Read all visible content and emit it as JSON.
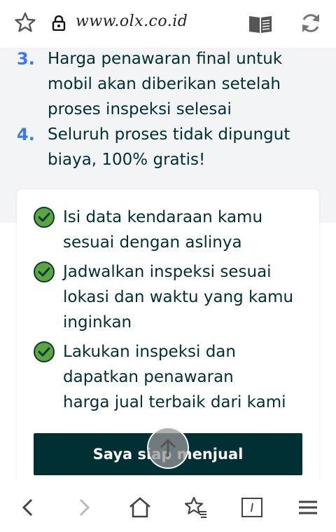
{
  "browser": {
    "url": "www.olx.co.id"
  },
  "steps": [
    {
      "num": "3.",
      "lines": [
        "Harga penawaran final untuk",
        "mobil akan diberikan setelah",
        "proses inspeksi selesai"
      ]
    },
    {
      "num": "4.",
      "lines": [
        "Seluruh proses tidak dipungut",
        "biaya, 100% gratis!"
      ]
    }
  ],
  "checklist": [
    {
      "lines": [
        "Isi data kendaraan kamu",
        "sesuai dengan aslinya"
      ]
    },
    {
      "lines": [
        "Jadwalkan inspeksi sesuai",
        "lokasi dan waktu yang kamu",
        "inginkan"
      ]
    },
    {
      "lines": [
        "Lakukan inspeksi dan",
        "dapatkan penawaran",
        "harga jual terbaik dari kami"
      ]
    }
  ],
  "cta": {
    "label": "Saya siap menjual"
  },
  "colors": {
    "step_number": "#3a77ff",
    "text": "#002f34",
    "check": "#5da541",
    "cta_bg": "#002f34"
  },
  "icons": {
    "top": [
      "star-icon",
      "lock-icon",
      "reader-mode-icon",
      "reload-icon"
    ],
    "bottom": [
      "back-icon",
      "forward-icon",
      "home-icon",
      "bookmarks-icon",
      "tabs-icon",
      "menu-icon"
    ],
    "floating": "scroll-to-top-icon"
  }
}
